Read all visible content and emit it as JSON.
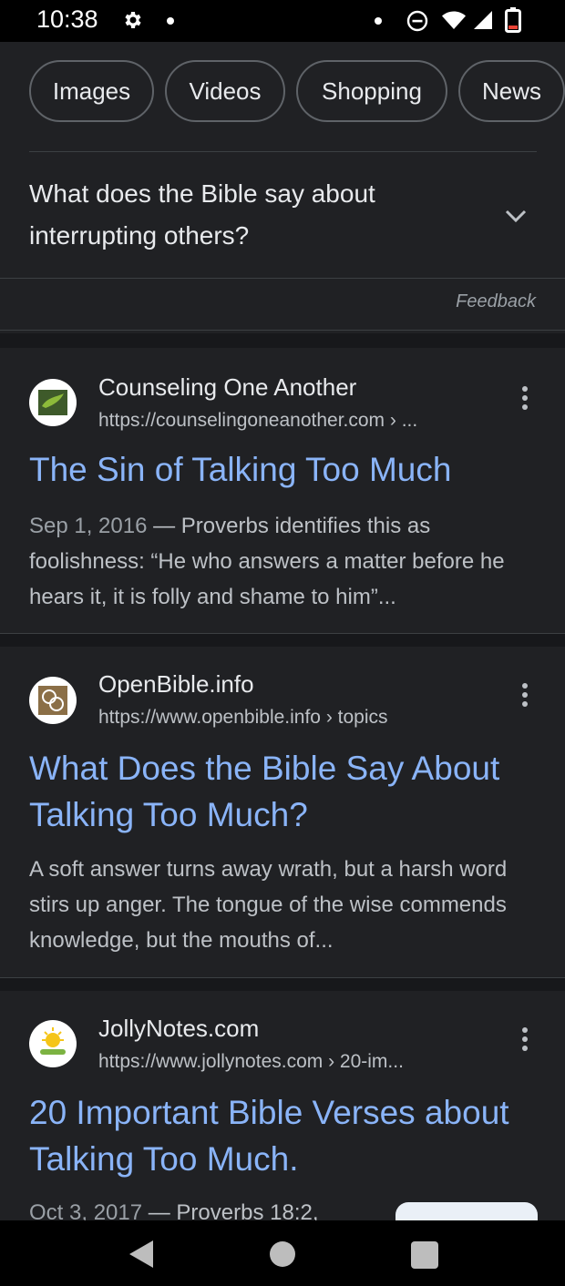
{
  "status_bar": {
    "time": "10:38"
  },
  "chips": [
    "Images",
    "Videos",
    "Shopping",
    "News"
  ],
  "faq": {
    "question": "What does the Bible say about interrupting others?"
  },
  "feedback_label": "Feedback",
  "results": [
    {
      "site": "Counseling One Another",
      "url": "https://counselingoneanother.com › ...",
      "title": "The Sin of Talking Too Much",
      "date": "Sep 1, 2016",
      "snippet": " — Proverbs identifies this as foolishness: “He who answers a matter before he hears it, it is folly and shame to him”..."
    },
    {
      "site": "OpenBible.info",
      "url": "https://www.openbible.info › topics",
      "title": "What Does the Bible Say About Talking Too Much?",
      "snippet": "A soft answer turns away wrath, but a harsh word stirs up anger. The tongue of the wise commends knowledge, but the mouths of..."
    },
    {
      "site": "JollyNotes.com",
      "url": "https://www.jollynotes.com › 20-im...",
      "title": "20 Important Bible Verses about Talking Too Much.",
      "date": "Oct 3, 2017",
      "snippet": " — Proverbs 18:2,"
    }
  ],
  "colors": {
    "background": "#202124",
    "link": "#8ab4f8",
    "text": "#e8eaed",
    "secondary_text": "#bdc1c6"
  }
}
